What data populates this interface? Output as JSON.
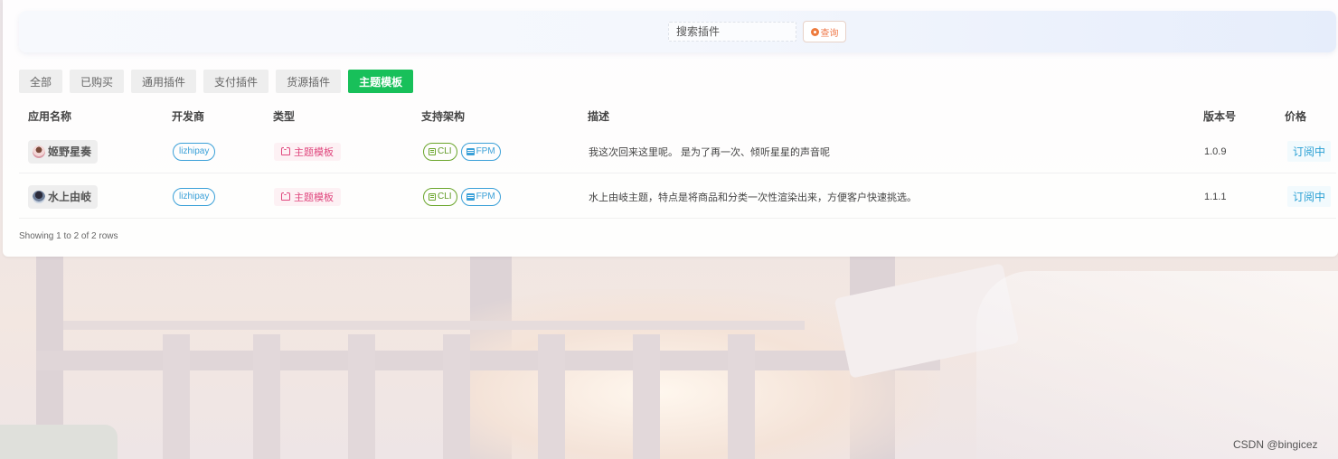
{
  "search": {
    "placeholder": "搜索插件",
    "button_label": "查询"
  },
  "tabs": [
    {
      "label": "全部",
      "active": false
    },
    {
      "label": "已购买",
      "active": false
    },
    {
      "label": "通用插件",
      "active": false
    },
    {
      "label": "支付插件",
      "active": false
    },
    {
      "label": "货源插件",
      "active": false
    },
    {
      "label": "主题模板",
      "active": true
    }
  ],
  "table": {
    "headers": [
      "应用名称",
      "开发商",
      "类型",
      "支持架构",
      "描述",
      "版本号",
      "价格"
    ],
    "rows": [
      {
        "name": "姬野星奏",
        "developer": "lizhipay",
        "type": "主题模板",
        "arch": [
          "CLI",
          "FPM"
        ],
        "description": "我这次回来这里呢。 是为了再一次、倾听星星的声音呢",
        "version": "1.0.9",
        "price": "订阅中"
      },
      {
        "name": "水上由岐",
        "developer": "lizhipay",
        "type": "主题模板",
        "arch": [
          "CLI",
          "FPM"
        ],
        "description": "水上由岐主题，特点是将商品和分类一次性渲染出来，方便客户快速挑选。",
        "version": "1.1.1",
        "price": "订阅中"
      }
    ]
  },
  "footer": {
    "pagination_text": "Showing 1 to 2 of 2 rows"
  },
  "watermark": "CSDN @bingicez",
  "colors": {
    "active_tab": "#18c05a",
    "developer_pill": "#3aa0d8",
    "type_pill": "#e0487e",
    "cli_pill": "#6aa52b",
    "price_text": "#2aa0d4"
  }
}
